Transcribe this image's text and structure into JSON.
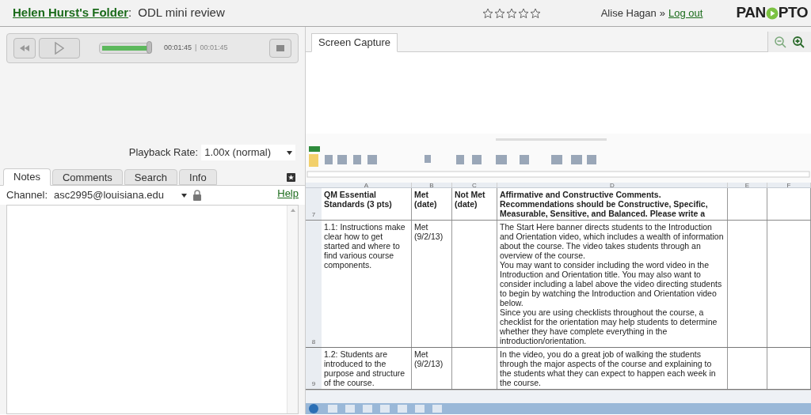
{
  "header": {
    "folder_link": "Helen Hurst's Folder",
    "separator": ":",
    "title": "ODL mini review",
    "rating": {
      "stars": 0
    },
    "user": "Alise Hagan",
    "user_separator": "»",
    "logout": "Log out",
    "logo": {
      "left": "PAN",
      "right": "PTO"
    }
  },
  "player": {
    "level": 1,
    "time": "00:01:45",
    "divider": "|",
    "duration": "00:01:45"
  },
  "playback_rate": {
    "label": "Playback Rate:",
    "value": "1.00x (normal)"
  },
  "tabs": [
    {
      "label": "Notes",
      "selected": true
    },
    {
      "label": "Comments",
      "selected": false
    },
    {
      "label": "Search",
      "selected": false
    },
    {
      "label": "Info",
      "selected": false
    }
  ],
  "channel": {
    "label": "Channel:",
    "value": "asc2995@louisiana.edu",
    "help": "Help"
  },
  "view_tabs": [
    {
      "label": "Screen Capture",
      "selected": true
    }
  ],
  "spreadsheet": {
    "columns": [
      "A",
      "B",
      "C",
      "D",
      "E",
      "F"
    ],
    "rows": [
      {
        "number": "7",
        "kind": "header",
        "cells": [
          [
            "QM Essential Standards (3 pts)"
          ],
          [
            "Met (date)"
          ],
          [
            "Not Met (date)"
          ],
          [
            "Affirmative and Constructive Comments. Recommendations should be Constructive, Specific, Measurable, Sensitive, and Balanced. Please write a"
          ]
        ]
      },
      {
        "number": "8",
        "kind": "body",
        "cells": [
          [
            "1.1: Instructions make clear how to get started and where to find various course components."
          ],
          [
            "Met (9/2/13)"
          ],
          [],
          [
            "The Start Here banner directs students to the Introduction and Orientation video, which includes a wealth of information about the course.  The video takes students through an overview of the course.",
            "You may want to consider including the word video in the Introduction and Orientation title. You may also want to consider including a label above the video directing students to begin by watching the Introduction and Orientation video below.",
            "Since you are using checklists throughout the course, a checklist for the orientation may help students to determine whether they have complete everything in the introduction/orientation."
          ]
        ]
      },
      {
        "number": "9",
        "kind": "body",
        "cells": [
          [
            "1.2: Students are introduced to the purpose and structure of the course."
          ],
          [
            "Met (9/2/13)"
          ],
          [],
          [
            "In the video, you do a great job of walking the students through the major aspects of the course and explaining to the students what they can expect to happen each week in the course."
          ]
        ]
      }
    ]
  }
}
